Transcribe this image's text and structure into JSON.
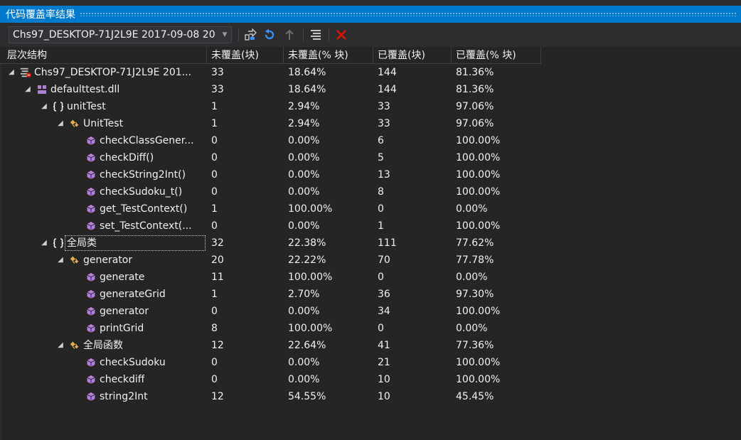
{
  "window": {
    "title": "代码覆盖率结果"
  },
  "toolbar": {
    "combo_value": "Chs97_DESKTOP-71J2L9E 2017-09-08 20",
    "buttons": [
      {
        "name": "export-results-icon"
      },
      {
        "name": "refresh-icon"
      },
      {
        "name": "import-results-icon"
      },
      {
        "name": "merge-results-icon"
      },
      {
        "name": "remove-results-icon"
      }
    ]
  },
  "columns": [
    "层次结构",
    "未覆盖(块)",
    "未覆盖(% 块)",
    "已覆盖(块)",
    "已覆盖(% 块)"
  ],
  "rows": [
    {
      "level": 0,
      "icon": "coverage-result-icon",
      "expanded": true,
      "name": "Chs97_DESKTOP-71J2L9E 201...",
      "not_covered_blocks": "33",
      "not_covered_pct": "18.64%",
      "covered_blocks": "144",
      "covered_pct": "81.36%"
    },
    {
      "level": 1,
      "icon": "assembly-icon",
      "expanded": true,
      "name": "defaulttest.dll",
      "not_covered_blocks": "33",
      "not_covered_pct": "18.64%",
      "covered_blocks": "144",
      "covered_pct": "81.36%"
    },
    {
      "level": 2,
      "icon": "namespace-icon",
      "expanded": true,
      "name": "unitTest",
      "not_covered_blocks": "1",
      "not_covered_pct": "2.94%",
      "covered_blocks": "33",
      "covered_pct": "97.06%"
    },
    {
      "level": 3,
      "icon": "class-icon",
      "expanded": true,
      "name": "UnitTest",
      "not_covered_blocks": "1",
      "not_covered_pct": "2.94%",
      "covered_blocks": "33",
      "covered_pct": "97.06%"
    },
    {
      "level": 4,
      "icon": "method-icon",
      "expanded": null,
      "name": "checkClassGener...",
      "not_covered_blocks": "0",
      "not_covered_pct": "0.00%",
      "covered_blocks": "6",
      "covered_pct": "100.00%"
    },
    {
      "level": 4,
      "icon": "method-icon",
      "expanded": null,
      "name": "checkDiff()",
      "not_covered_blocks": "0",
      "not_covered_pct": "0.00%",
      "covered_blocks": "5",
      "covered_pct": "100.00%"
    },
    {
      "level": 4,
      "icon": "method-icon",
      "expanded": null,
      "name": "checkString2Int()",
      "not_covered_blocks": "0",
      "not_covered_pct": "0.00%",
      "covered_blocks": "13",
      "covered_pct": "100.00%"
    },
    {
      "level": 4,
      "icon": "method-icon",
      "expanded": null,
      "name": "checkSudoku_t()",
      "not_covered_blocks": "0",
      "not_covered_pct": "0.00%",
      "covered_blocks": "8",
      "covered_pct": "100.00%"
    },
    {
      "level": 4,
      "icon": "method-icon",
      "expanded": null,
      "name": "get_TestContext()",
      "not_covered_blocks": "1",
      "not_covered_pct": "100.00%",
      "covered_blocks": "0",
      "covered_pct": "0.00%"
    },
    {
      "level": 4,
      "icon": "method-icon",
      "expanded": null,
      "name": "set_TestContext(...",
      "not_covered_blocks": "0",
      "not_covered_pct": "0.00%",
      "covered_blocks": "1",
      "covered_pct": "100.00%"
    },
    {
      "level": 2,
      "icon": "namespace-icon",
      "expanded": true,
      "name": "全局类",
      "selected": true,
      "not_covered_blocks": "32",
      "not_covered_pct": "22.38%",
      "covered_blocks": "111",
      "covered_pct": "77.62%"
    },
    {
      "level": 3,
      "icon": "class-icon",
      "expanded": true,
      "name": "generator",
      "not_covered_blocks": "20",
      "not_covered_pct": "22.22%",
      "covered_blocks": "70",
      "covered_pct": "77.78%"
    },
    {
      "level": 4,
      "icon": "method-icon",
      "expanded": null,
      "name": "generate",
      "not_covered_blocks": "11",
      "not_covered_pct": "100.00%",
      "covered_blocks": "0",
      "covered_pct": "0.00%"
    },
    {
      "level": 4,
      "icon": "method-icon",
      "expanded": null,
      "name": "generateGrid",
      "not_covered_blocks": "1",
      "not_covered_pct": "2.70%",
      "covered_blocks": "36",
      "covered_pct": "97.30%"
    },
    {
      "level": 4,
      "icon": "method-icon",
      "expanded": null,
      "name": "generator",
      "not_covered_blocks": "0",
      "not_covered_pct": "0.00%",
      "covered_blocks": "34",
      "covered_pct": "100.00%"
    },
    {
      "level": 4,
      "icon": "method-icon",
      "expanded": null,
      "name": "printGrid",
      "not_covered_blocks": "8",
      "not_covered_pct": "100.00%",
      "covered_blocks": "0",
      "covered_pct": "0.00%"
    },
    {
      "level": 3,
      "icon": "class-icon",
      "expanded": true,
      "name": "全局函数",
      "not_covered_blocks": "12",
      "not_covered_pct": "22.64%",
      "covered_blocks": "41",
      "covered_pct": "77.36%"
    },
    {
      "level": 4,
      "icon": "method-icon",
      "expanded": null,
      "name": "checkSudoku",
      "not_covered_blocks": "0",
      "not_covered_pct": "0.00%",
      "covered_blocks": "21",
      "covered_pct": "100.00%"
    },
    {
      "level": 4,
      "icon": "method-icon",
      "expanded": null,
      "name": "checkdiff",
      "not_covered_blocks": "0",
      "not_covered_pct": "0.00%",
      "covered_blocks": "10",
      "covered_pct": "100.00%"
    },
    {
      "level": 4,
      "icon": "method-icon",
      "expanded": null,
      "name": "string2Int",
      "not_covered_blocks": "12",
      "not_covered_pct": "54.55%",
      "covered_blocks": "10",
      "covered_pct": "45.45%"
    }
  ],
  "colors": {
    "title_bar": "#007acc",
    "background": "#252526",
    "toolbar": "#2d2d30",
    "method_icon": "#b180d7",
    "namespace_icon": "#f1f1f1",
    "class_icon": "#e8ab53",
    "remove_icon": "#e51400",
    "refresh_icon": "#3794ff"
  }
}
